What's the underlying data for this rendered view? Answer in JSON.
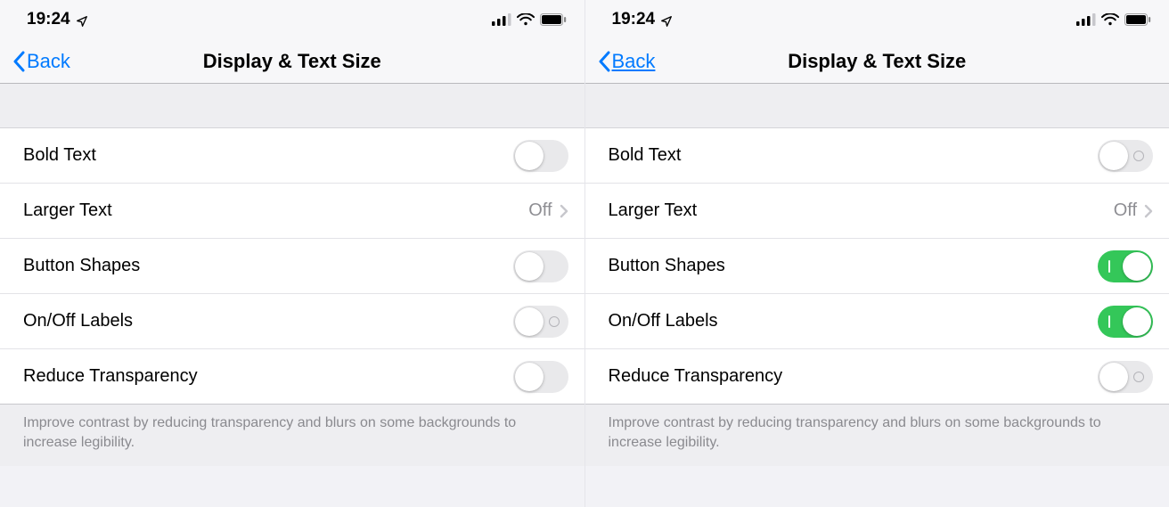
{
  "left": {
    "status": {
      "time": "19:24"
    },
    "nav": {
      "back": "Back",
      "title": "Display & Text Size",
      "back_underlined": false
    },
    "rows": {
      "bold": {
        "label": "Bold Text",
        "on": false,
        "show_labels": false
      },
      "larger": {
        "label": "Larger Text",
        "value": "Off"
      },
      "shapes": {
        "label": "Button Shapes",
        "on": false,
        "show_labels": false
      },
      "onoff": {
        "label": "On/Off Labels",
        "on": false,
        "show_labels": true
      },
      "trans": {
        "label": "Reduce Transparency",
        "on": false,
        "show_labels": false
      }
    },
    "footer": "Improve contrast by reducing transparency and blurs on some backgrounds to increase legibility."
  },
  "right": {
    "status": {
      "time": "19:24"
    },
    "nav": {
      "back": "Back",
      "title": "Display & Text Size",
      "back_underlined": true
    },
    "rows": {
      "bold": {
        "label": "Bold Text",
        "on": false,
        "show_labels": true
      },
      "larger": {
        "label": "Larger Text",
        "value": "Off"
      },
      "shapes": {
        "label": "Button Shapes",
        "on": true,
        "show_labels": true
      },
      "onoff": {
        "label": "On/Off Labels",
        "on": true,
        "show_labels": true
      },
      "trans": {
        "label": "Reduce Transparency",
        "on": false,
        "show_labels": true
      }
    },
    "footer": "Improve contrast by reducing transparency and blurs on some backgrounds to increase legibility."
  }
}
